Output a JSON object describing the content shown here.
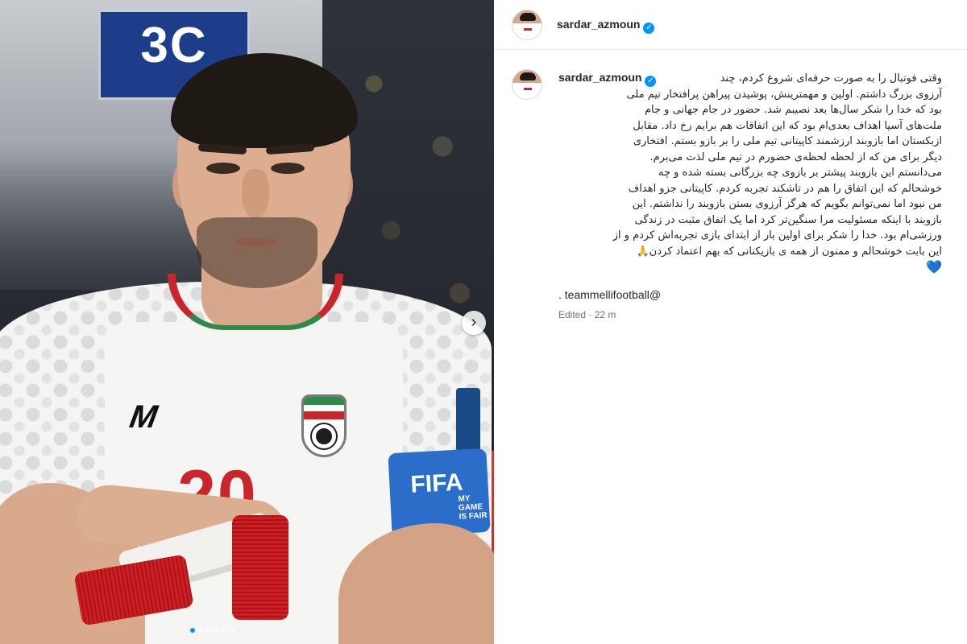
{
  "post": {
    "username": "sardar_azmoun",
    "verified_icon": "verified-badge-icon",
    "jersey_number": "20",
    "armband_text": "FIFA",
    "armband_sub": "MY GAME IS FAIR",
    "board_text": "3C",
    "carousel": {
      "next_icon": "chevron-right-icon",
      "total_slides": 6,
      "active_index": 0
    }
  },
  "caption": {
    "lines": [
      "وقتی فوتبال را به صورت حرفه‌ای شروع کردم، چند",
      "آرزوی بزرگ داشتم. اولین و مهمترینش، پوشیدن پیراهن پرافتخار تیم ملی",
      "بود که خدا را شکر سال‌ها بعد نصیبم شد. حضور در جام جهانی و جام",
      "ملت‌های آسیا اهداف بعدی‌ام بود که این اتفاقات هم برایم رخ داد. مقابل",
      "ازبکستان اما بازوبند ارزشمند کاپیتانی تیم ملی را بر بازو بستم. افتخاری",
      "دیگر برای من که از لحظه لحظه‌ی حضورم در تیم ملی لذت می‌برم.",
      "می‌دانستم این بازوبند پیشتر بر بازوی چه بزرگانی بسته شده و چه",
      "خوشحالم که این اتفاق را هم در تاشکند تجربه کردم. کاپیتانی جزو اهداف",
      "من نبود اما نمی‌توانم بگویم که هرگز آرزوی بستن بازوبند را نداشتم. این",
      "بازوبند با اینکه مسئولیت مرا سنگین‌تر کرد اما یک اتفاق مثبت در زندگی",
      "ورزشی‌ام بود. خدا را شکر برای اولین بار از ابتدای بازی تجربه‌اش کردم و از",
      "این بابت خوشحالم و ممنون از همه ی بازیکنانی که بهم اعتماد کردن🙏"
    ],
    "heart": "💙",
    "mention": ". teammellifootball@",
    "edited": "Edited · 22 m"
  },
  "colors": {
    "accent": "#0095f6",
    "text": "#262626",
    "muted": "#737373",
    "jersey_red": "#c8262b",
    "armband_blue": "#2b6ec9"
  }
}
